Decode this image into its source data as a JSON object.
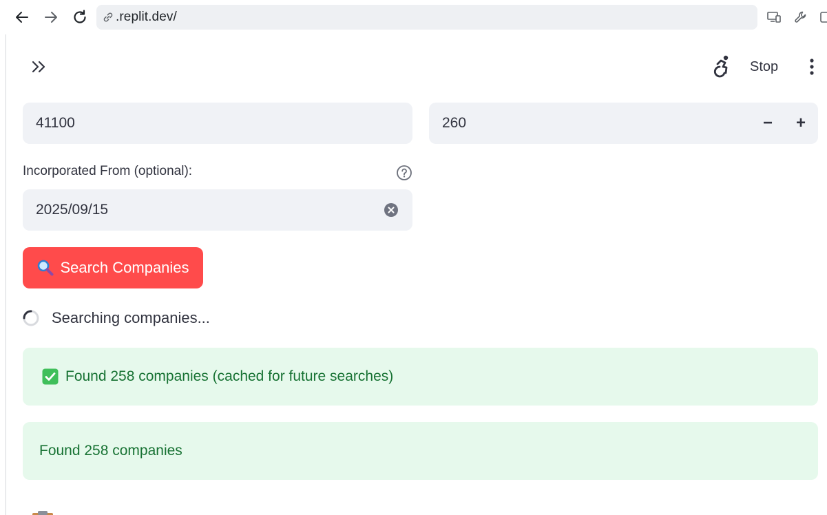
{
  "browser": {
    "url": ".replit.dev/",
    "icons": [
      "back-icon",
      "forward-icon",
      "reload-icon",
      "link-icon",
      "devices-icon",
      "wrench-icon",
      "window-icon"
    ]
  },
  "header": {
    "stop_label": "Stop",
    "icons": [
      "sidebar-expand-icon",
      "accessibility-running-icon",
      "more-vertical-icon"
    ]
  },
  "form": {
    "code_value": "41100",
    "count_value": "260",
    "stepper_minus": "−",
    "stepper_plus": "+",
    "incorporated_label": "Incorporated From (optional):",
    "incorporated_value": "2025/09/15",
    "search_button_label": "Search Companies",
    "search_button_icon": "magnifier-icon"
  },
  "status": {
    "spinner_text": "Searching companies..."
  },
  "alerts": {
    "first": "Found 258 companies (cached for future searches)",
    "second": "Found 258 companies"
  },
  "colors": {
    "primary_button": "#ff4b4b",
    "success_bg": "#e6f9ec",
    "success_text": "#177233",
    "input_bg": "#f0f2f6"
  }
}
